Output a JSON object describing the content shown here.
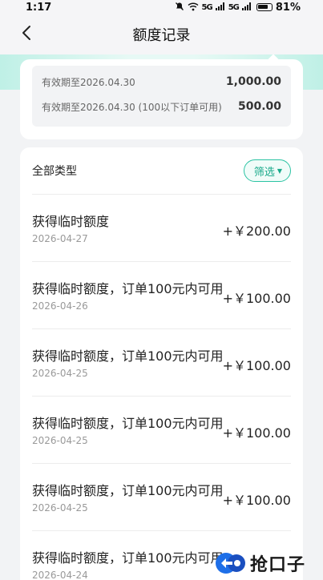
{
  "status_bar": {
    "time": "1:17",
    "network_1": "5G",
    "network_2": "5G",
    "battery": "81%"
  },
  "header": {
    "title": "额度记录",
    "back_icon": "chevron-left-icon"
  },
  "quota": [
    {
      "label": "有效期至2026.04.30",
      "amount": "1,000.00"
    },
    {
      "label": "有效期至2026.04.30 (100以下订单可用)",
      "amount": "500.00"
    }
  ],
  "list": {
    "type_label": "全部类型",
    "filter_label": "筛选",
    "records": [
      {
        "title": "获得临时额度",
        "date": "2026-04-27",
        "amount": "+￥200.00"
      },
      {
        "title": "获得临时额度，订单100元内可用",
        "date": "2026-04-26",
        "amount": "+￥100.00"
      },
      {
        "title": "获得临时额度，订单100元内可用",
        "date": "2026-04-25",
        "amount": "+￥100.00"
      },
      {
        "title": "获得临时额度，订单100元内可用",
        "date": "2026-04-25",
        "amount": "+￥100.00"
      },
      {
        "title": "获得临时额度，订单100元内可用",
        "date": "2026-04-25",
        "amount": "+￥100.00"
      },
      {
        "title": "获得临时额度，订单100元内可用",
        "date": "2026-04-24",
        "amount": ""
      }
    ]
  },
  "watermark": {
    "text": "抢口子"
  },
  "colors": {
    "accent": "#17a98a",
    "accent_border": "#2bc3a3",
    "teal_band": "#bff0e6",
    "background": "#f2f3f5"
  }
}
